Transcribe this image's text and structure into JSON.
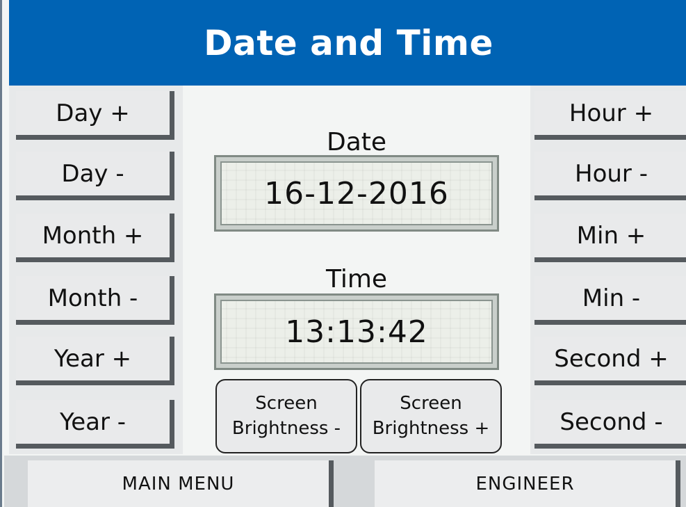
{
  "title": "Date and Time",
  "left_buttons": [
    "Day +",
    "Day -",
    "Month +",
    "Month -",
    "Year +",
    "Year -"
  ],
  "right_buttons": [
    "Hour +",
    "Hour -",
    "Min +",
    "Min -",
    "Second +",
    "Second -"
  ],
  "date": {
    "label": "Date",
    "value": "16-12-2016"
  },
  "time": {
    "label": "Time",
    "value": "13:13:42"
  },
  "brightness": {
    "minus": {
      "line1": "Screen",
      "line2": "Brightness -"
    },
    "plus": {
      "line1": "Screen",
      "line2": "Brightness +"
    }
  },
  "footer": {
    "main_menu": "MAIN MENU",
    "engineer": "ENGINEER"
  },
  "colors": {
    "title_bar": "#0063b4",
    "background": "#f3f5f4",
    "button": "#e9eaeb",
    "button_shadow": "#555a5e"
  }
}
